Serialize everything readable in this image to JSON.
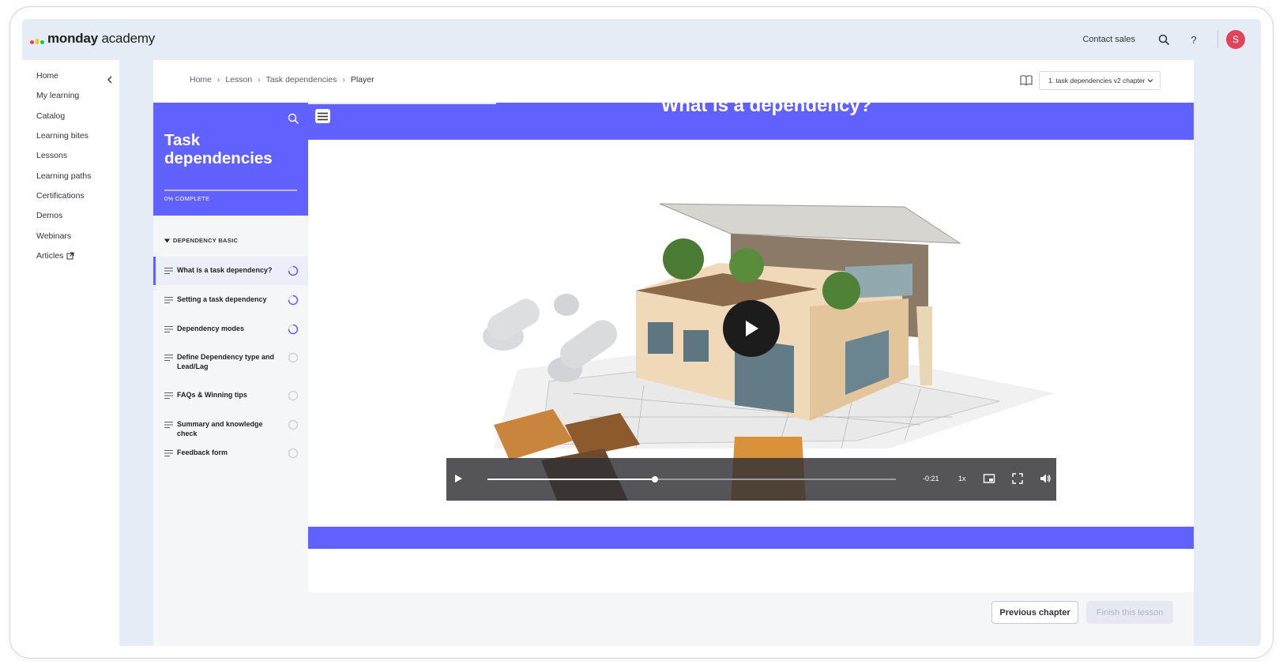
{
  "brand": {
    "name_bold": "monday",
    "name_light": " academy",
    "logo_colors": [
      "#ff3d57",
      "#ffcb00",
      "#00d647"
    ]
  },
  "topbar": {
    "contact_sales": "Contact sales",
    "search_icon": "search-icon",
    "help_label": "?",
    "avatar_initial": "S",
    "avatar_color": "#e2445c"
  },
  "leftnav": {
    "items": [
      {
        "label": "Home"
      },
      {
        "label": "My learning"
      },
      {
        "label": "Catalog"
      },
      {
        "label": "Learning bites"
      },
      {
        "label": "Lessons"
      },
      {
        "label": "Learning paths"
      },
      {
        "label": "Certifications"
      },
      {
        "label": "Demos"
      },
      {
        "label": "Webinars"
      },
      {
        "label": "Articles",
        "icon": "external-link-icon"
      }
    ]
  },
  "breadcrumb": {
    "items": [
      "Home",
      "Lesson",
      "Task dependencies",
      "Player"
    ]
  },
  "chapter_select": {
    "value": "1. task dependencies v2 chapter"
  },
  "course": {
    "title": "Task dependencies",
    "progress_label": "0% COMPLETE",
    "progress_fraction": 0.0,
    "section_title": "DEPENDENCY BASIC",
    "lessons": [
      {
        "title": "What is a task dependency?",
        "status": "in-progress"
      },
      {
        "title": "Setting a task dependency",
        "status": "in-progress"
      },
      {
        "title": "Dependency modes",
        "status": "in-progress"
      },
      {
        "title": "Define Dependency type and Lead/Lag",
        "status": "not-started"
      },
      {
        "title": "FAQs & Winning tips",
        "status": "not-started"
      },
      {
        "title": "Summary and knowledge check",
        "status": "not-started"
      },
      {
        "title": "Feedback form",
        "status": "not-started"
      }
    ]
  },
  "content": {
    "heading": "What is a dependency?",
    "accent_color": "#6161ff"
  },
  "video": {
    "time_remaining": "-0:21",
    "speed": "1x",
    "progress_fraction": 0.41
  },
  "footer": {
    "previous_label": "Previous chapter",
    "finish_label": "Finish this lesson"
  }
}
